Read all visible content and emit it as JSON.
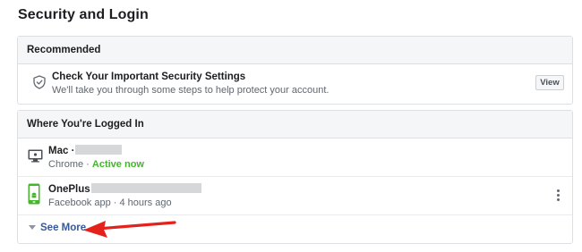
{
  "page": {
    "title": "Security and Login"
  },
  "recommended": {
    "header": "Recommended",
    "item": {
      "icon": "shield-check-icon",
      "title": "Check Your Important Security Settings",
      "subtitle": "We'll take you through some steps to help protect your account.",
      "button_label": "View"
    }
  },
  "logged_in": {
    "header": "Where You're Logged In",
    "sessions": [
      {
        "icon": "desktop-mac-icon",
        "device": "Mac ·",
        "app": "Chrome ·",
        "status": "Active now",
        "status_color": "#42b72a"
      },
      {
        "icon": "android-phone-icon",
        "device": "OnePlus",
        "app": "Facebook app · 4 hours ago"
      }
    ],
    "see_more_label": "See More"
  },
  "colors": {
    "link": "#385898",
    "arrow": "#e4221b",
    "active": "#42b72a"
  }
}
